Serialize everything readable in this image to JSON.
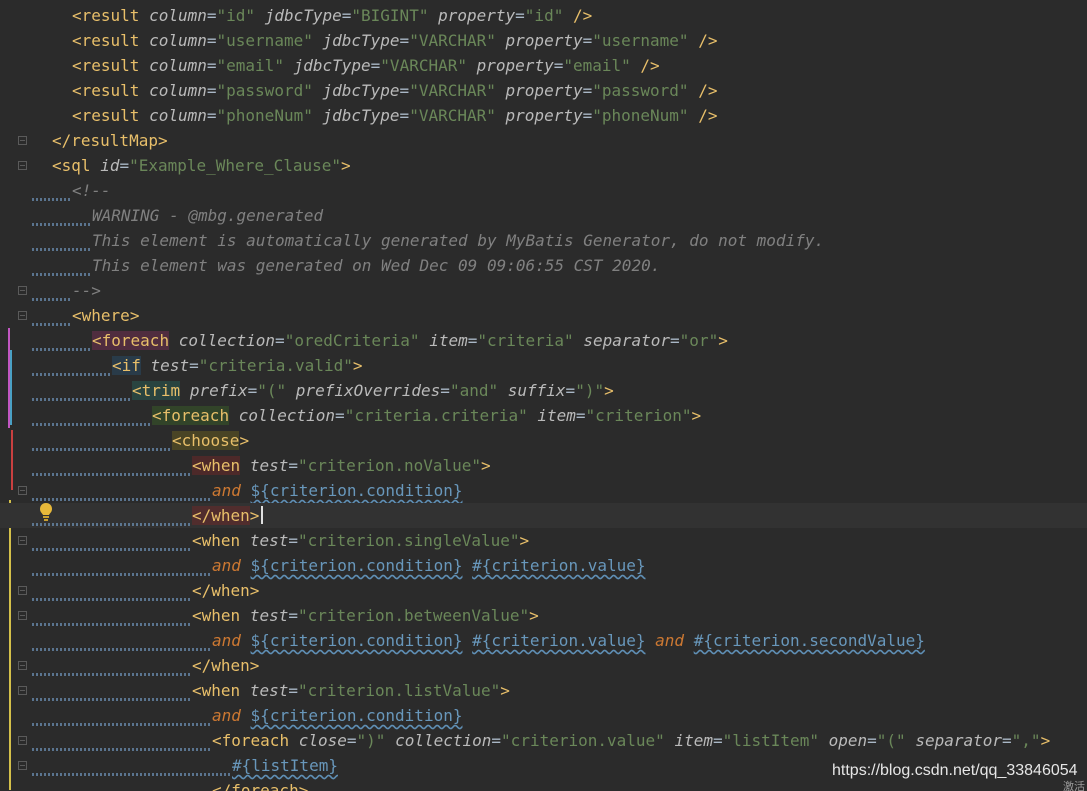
{
  "editor": {
    "watermark": "https://blog.csdn.net/qq_33846054",
    "watermark_extra": "激活"
  },
  "lines": [
    {
      "tokens": [
        {
          "t": "br",
          "v": "<"
        },
        {
          "t": "tag",
          "v": "result"
        },
        {
          "t": "plain",
          "v": " "
        },
        {
          "t": "attr",
          "v": "column"
        },
        {
          "t": "plain",
          "v": "="
        },
        {
          "t": "val",
          "v": "\"id\""
        },
        {
          "t": "plain",
          "v": " "
        },
        {
          "t": "attr",
          "v": "jdbcType"
        },
        {
          "t": "plain",
          "v": "="
        },
        {
          "t": "val",
          "v": "\"BIGINT\""
        },
        {
          "t": "plain",
          "v": " "
        },
        {
          "t": "attr",
          "v": "property"
        },
        {
          "t": "plain",
          "v": "="
        },
        {
          "t": "val",
          "v": "\"id\""
        },
        {
          "t": "plain",
          "v": " "
        },
        {
          "t": "br",
          "v": "/>"
        }
      ]
    },
    {
      "tokens": [
        {
          "t": "br",
          "v": "<"
        },
        {
          "t": "tag",
          "v": "result"
        },
        {
          "t": "plain",
          "v": " "
        },
        {
          "t": "attr",
          "v": "column"
        },
        {
          "t": "plain",
          "v": "="
        },
        {
          "t": "val",
          "v": "\"username\""
        },
        {
          "t": "plain",
          "v": " "
        },
        {
          "t": "attr",
          "v": "jdbcType"
        },
        {
          "t": "plain",
          "v": "="
        },
        {
          "t": "val",
          "v": "\"VARCHAR\""
        },
        {
          "t": "plain",
          "v": " "
        },
        {
          "t": "attr",
          "v": "property"
        },
        {
          "t": "plain",
          "v": "="
        },
        {
          "t": "val",
          "v": "\"username\""
        },
        {
          "t": "plain",
          "v": " "
        },
        {
          "t": "br",
          "v": "/>"
        }
      ]
    },
    {
      "tokens": [
        {
          "t": "br",
          "v": "<"
        },
        {
          "t": "tag",
          "v": "result"
        },
        {
          "t": "plain",
          "v": " "
        },
        {
          "t": "attr",
          "v": "column"
        },
        {
          "t": "plain",
          "v": "="
        },
        {
          "t": "val",
          "v": "\"email\""
        },
        {
          "t": "plain",
          "v": " "
        },
        {
          "t": "attr",
          "v": "jdbcType"
        },
        {
          "t": "plain",
          "v": "="
        },
        {
          "t": "val",
          "v": "\"VARCHAR\""
        },
        {
          "t": "plain",
          "v": " "
        },
        {
          "t": "attr",
          "v": "property"
        },
        {
          "t": "plain",
          "v": "="
        },
        {
          "t": "val",
          "v": "\"email\""
        },
        {
          "t": "plain",
          "v": " "
        },
        {
          "t": "br",
          "v": "/>"
        }
      ]
    },
    {
      "tokens": [
        {
          "t": "br",
          "v": "<"
        },
        {
          "t": "tag",
          "v": "result"
        },
        {
          "t": "plain",
          "v": " "
        },
        {
          "t": "attr",
          "v": "column"
        },
        {
          "t": "plain",
          "v": "="
        },
        {
          "t": "val",
          "v": "\"password\""
        },
        {
          "t": "plain",
          "v": " "
        },
        {
          "t": "attr",
          "v": "jdbcType"
        },
        {
          "t": "plain",
          "v": "="
        },
        {
          "t": "val",
          "v": "\"VARCHAR\""
        },
        {
          "t": "plain",
          "v": " "
        },
        {
          "t": "attr",
          "v": "property"
        },
        {
          "t": "plain",
          "v": "="
        },
        {
          "t": "val",
          "v": "\"password\""
        },
        {
          "t": "plain",
          "v": " "
        },
        {
          "t": "br",
          "v": "/>"
        }
      ]
    },
    {
      "tokens": [
        {
          "t": "br",
          "v": "<"
        },
        {
          "t": "tag",
          "v": "result"
        },
        {
          "t": "plain",
          "v": " "
        },
        {
          "t": "attr",
          "v": "column"
        },
        {
          "t": "plain",
          "v": "="
        },
        {
          "t": "val",
          "v": "\"phoneNum\""
        },
        {
          "t": "plain",
          "v": " "
        },
        {
          "t": "attr",
          "v": "jdbcType"
        },
        {
          "t": "plain",
          "v": "="
        },
        {
          "t": "val",
          "v": "\"VARCHAR\""
        },
        {
          "t": "plain",
          "v": " "
        },
        {
          "t": "attr",
          "v": "property"
        },
        {
          "t": "plain",
          "v": "="
        },
        {
          "t": "val",
          "v": "\"phoneNum\""
        },
        {
          "t": "plain",
          "v": " "
        },
        {
          "t": "br",
          "v": "/>"
        }
      ]
    },
    {
      "tokens": [
        {
          "t": "br",
          "v": "</"
        },
        {
          "t": "tag",
          "v": "resultMap"
        },
        {
          "t": "br",
          "v": ">"
        }
      ]
    },
    {
      "tokens": [
        {
          "t": "br",
          "v": "<"
        },
        {
          "t": "tag",
          "v": "sql"
        },
        {
          "t": "plain",
          "v": " "
        },
        {
          "t": "attr",
          "v": "id"
        },
        {
          "t": "plain",
          "v": "="
        },
        {
          "t": "val",
          "v": "\"Example_Where_Clause\""
        },
        {
          "t": "br",
          "v": ">"
        }
      ]
    },
    {
      "tokens": [
        {
          "t": "comment",
          "v": "<!--"
        }
      ]
    },
    {
      "tokens": [
        {
          "t": "comment",
          "v": "WARNING - @mbg.generated"
        }
      ]
    },
    {
      "tokens": [
        {
          "t": "comment",
          "v": "This element is automatically generated by MyBatis Generator, do not modify."
        }
      ]
    },
    {
      "tokens": [
        {
          "t": "comment",
          "v": "This element was generated on Wed Dec 09 09:06:55 CST 2020."
        }
      ]
    },
    {
      "tokens": [
        {
          "t": "comment",
          "v": "-->"
        }
      ]
    },
    {
      "tokens": [
        {
          "t": "br",
          "v": "<"
        },
        {
          "t": "tag",
          "v": "where"
        },
        {
          "t": "br",
          "v": ">"
        }
      ]
    },
    {
      "tokens": [
        {
          "t": "br",
          "v": "<"
        },
        {
          "t": "tag",
          "v": "foreach"
        },
        {
          "t": "plain",
          "v": " "
        },
        {
          "t": "attr",
          "v": "collection"
        },
        {
          "t": "plain",
          "v": "="
        },
        {
          "t": "val",
          "v": "\"oredCriteria\""
        },
        {
          "t": "plain",
          "v": " "
        },
        {
          "t": "attr",
          "v": "item"
        },
        {
          "t": "plain",
          "v": "="
        },
        {
          "t": "val",
          "v": "\"criteria\""
        },
        {
          "t": "plain",
          "v": " "
        },
        {
          "t": "attr",
          "v": "separator"
        },
        {
          "t": "plain",
          "v": "="
        },
        {
          "t": "val",
          "v": "\"or\""
        },
        {
          "t": "br",
          "v": ">"
        }
      ]
    },
    {
      "tokens": [
        {
          "t": "br",
          "v": "<"
        },
        {
          "t": "tag",
          "v": "if"
        },
        {
          "t": "plain",
          "v": " "
        },
        {
          "t": "attr",
          "v": "test"
        },
        {
          "t": "plain",
          "v": "="
        },
        {
          "t": "val",
          "v": "\"criteria.valid\""
        },
        {
          "t": "br",
          "v": ">"
        }
      ]
    },
    {
      "tokens": [
        {
          "t": "br",
          "v": "<"
        },
        {
          "t": "tag",
          "v": "trim"
        },
        {
          "t": "plain",
          "v": " "
        },
        {
          "t": "attr",
          "v": "prefix"
        },
        {
          "t": "plain",
          "v": "="
        },
        {
          "t": "val",
          "v": "\"(\""
        },
        {
          "t": "plain",
          "v": " "
        },
        {
          "t": "attr",
          "v": "prefixOverrides"
        },
        {
          "t": "plain",
          "v": "="
        },
        {
          "t": "val",
          "v": "\"and\""
        },
        {
          "t": "plain",
          "v": " "
        },
        {
          "t": "attr",
          "v": "suffix"
        },
        {
          "t": "plain",
          "v": "="
        },
        {
          "t": "val",
          "v": "\")\""
        },
        {
          "t": "br",
          "v": ">"
        }
      ]
    },
    {
      "tokens": [
        {
          "t": "br",
          "v": "<"
        },
        {
          "t": "tag",
          "v": "foreach"
        },
        {
          "t": "plain",
          "v": " "
        },
        {
          "t": "attr",
          "v": "collection"
        },
        {
          "t": "plain",
          "v": "="
        },
        {
          "t": "val",
          "v": "\"criteria.criteria\""
        },
        {
          "t": "plain",
          "v": " "
        },
        {
          "t": "attr",
          "v": "item"
        },
        {
          "t": "plain",
          "v": "="
        },
        {
          "t": "val",
          "v": "\"criterion\""
        },
        {
          "t": "br",
          "v": ">"
        }
      ]
    },
    {
      "tokens": [
        {
          "t": "br",
          "v": "<"
        },
        {
          "t": "tag",
          "v": "choose"
        },
        {
          "t": "br",
          "v": ">"
        }
      ]
    },
    {
      "tokens": [
        {
          "t": "br",
          "v": "<"
        },
        {
          "t": "tag",
          "v": "when"
        },
        {
          "t": "plain",
          "v": " "
        },
        {
          "t": "attr",
          "v": "test"
        },
        {
          "t": "plain",
          "v": "="
        },
        {
          "t": "val",
          "v": "\"criterion.noValue\""
        },
        {
          "t": "br",
          "v": ">"
        }
      ]
    },
    {
      "tokens": [
        {
          "t": "kw",
          "v": "and"
        },
        {
          "t": "plain",
          "v": " "
        },
        {
          "t": "expr",
          "v": "${criterion.condition}"
        }
      ]
    },
    {
      "tokens": [
        {
          "t": "br",
          "v": "</"
        },
        {
          "t": "tag",
          "v": "when"
        },
        {
          "t": "br",
          "v": ">"
        }
      ]
    },
    {
      "tokens": [
        {
          "t": "br",
          "v": "<"
        },
        {
          "t": "tag",
          "v": "when"
        },
        {
          "t": "plain",
          "v": " "
        },
        {
          "t": "attr",
          "v": "test"
        },
        {
          "t": "plain",
          "v": "="
        },
        {
          "t": "val",
          "v": "\"criterion.singleValue\""
        },
        {
          "t": "br",
          "v": ">"
        }
      ]
    },
    {
      "tokens": [
        {
          "t": "kw",
          "v": "and"
        },
        {
          "t": "plain",
          "v": " "
        },
        {
          "t": "expr",
          "v": "${criterion.condition}"
        },
        {
          "t": "plain",
          "v": " "
        },
        {
          "t": "expr",
          "v": "#{criterion.value}"
        }
      ]
    },
    {
      "tokens": [
        {
          "t": "br",
          "v": "</"
        },
        {
          "t": "tag",
          "v": "when"
        },
        {
          "t": "br",
          "v": ">"
        }
      ]
    },
    {
      "tokens": [
        {
          "t": "br",
          "v": "<"
        },
        {
          "t": "tag",
          "v": "when"
        },
        {
          "t": "plain",
          "v": " "
        },
        {
          "t": "attr",
          "v": "test"
        },
        {
          "t": "plain",
          "v": "="
        },
        {
          "t": "val",
          "v": "\"criterion.betweenValue\""
        },
        {
          "t": "br",
          "v": ">"
        }
      ]
    },
    {
      "tokens": [
        {
          "t": "kw",
          "v": "and"
        },
        {
          "t": "plain",
          "v": " "
        },
        {
          "t": "expr",
          "v": "${criterion.condition}"
        },
        {
          "t": "plain",
          "v": " "
        },
        {
          "t": "expr",
          "v": "#{criterion.value}"
        },
        {
          "t": "plain",
          "v": " "
        },
        {
          "t": "kw",
          "v": "and"
        },
        {
          "t": "plain",
          "v": " "
        },
        {
          "t": "expr",
          "v": "#{criterion.secondValue}"
        }
      ]
    },
    {
      "tokens": [
        {
          "t": "br",
          "v": "</"
        },
        {
          "t": "tag",
          "v": "when"
        },
        {
          "t": "br",
          "v": ">"
        }
      ]
    },
    {
      "tokens": [
        {
          "t": "br",
          "v": "<"
        },
        {
          "t": "tag",
          "v": "when"
        },
        {
          "t": "plain",
          "v": " "
        },
        {
          "t": "attr",
          "v": "test"
        },
        {
          "t": "plain",
          "v": "="
        },
        {
          "t": "val",
          "v": "\"criterion.listValue\""
        },
        {
          "t": "br",
          "v": ">"
        }
      ]
    },
    {
      "tokens": [
        {
          "t": "kw",
          "v": "and"
        },
        {
          "t": "plain",
          "v": " "
        },
        {
          "t": "expr",
          "v": "${criterion.condition}"
        }
      ]
    },
    {
      "tokens": [
        {
          "t": "br",
          "v": "<"
        },
        {
          "t": "tag",
          "v": "foreach"
        },
        {
          "t": "plain",
          "v": " "
        },
        {
          "t": "attr",
          "v": "close"
        },
        {
          "t": "plain",
          "v": "="
        },
        {
          "t": "val",
          "v": "\")\""
        },
        {
          "t": "plain",
          "v": " "
        },
        {
          "t": "attr",
          "v": "collection"
        },
        {
          "t": "plain",
          "v": "="
        },
        {
          "t": "val",
          "v": "\"criterion.value\""
        },
        {
          "t": "plain",
          "v": " "
        },
        {
          "t": "attr",
          "v": "item"
        },
        {
          "t": "plain",
          "v": "="
        },
        {
          "t": "val",
          "v": "\"listItem\""
        },
        {
          "t": "plain",
          "v": " "
        },
        {
          "t": "attr",
          "v": "open"
        },
        {
          "t": "plain",
          "v": "="
        },
        {
          "t": "val",
          "v": "\"(\""
        },
        {
          "t": "plain",
          "v": " "
        },
        {
          "t": "attr",
          "v": "separator"
        },
        {
          "t": "plain",
          "v": "="
        },
        {
          "t": "val",
          "v": "\",\""
        },
        {
          "t": "br",
          "v": ">"
        }
      ]
    },
    {
      "tokens": [
        {
          "t": "expr",
          "v": "#{listItem}"
        }
      ]
    },
    {
      "tokens": [
        {
          "t": "br",
          "v": "</"
        },
        {
          "t": "tag",
          "v": "foreach"
        },
        {
          "t": "br",
          "v": ">"
        }
      ]
    }
  ]
}
